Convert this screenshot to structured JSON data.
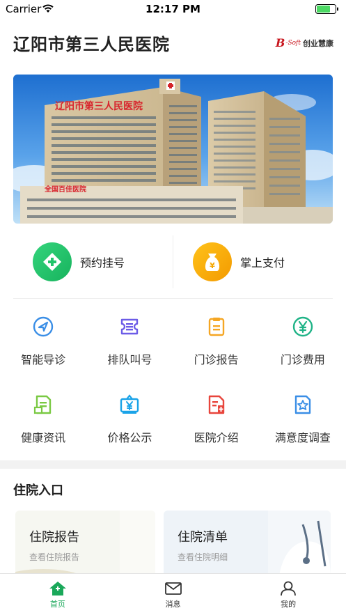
{
  "status_bar": {
    "carrier": "Carrier",
    "time": "12:17 PM"
  },
  "header": {
    "title": "辽阳市第三人民医院",
    "brand": {
      "b": "B",
      "soft": "-Soft",
      "cn": "创业慧康"
    }
  },
  "banner": {
    "sign_top": "辽阳市第三人民医院",
    "sign_bottom": "全国百佳医院"
  },
  "main_actions": [
    {
      "label": "预约挂号",
      "icon": "plus-cross-icon",
      "color": "#22c46a"
    },
    {
      "label": "掌上支付",
      "icon": "money-bag-icon",
      "color": "#f5a700"
    }
  ],
  "grid": [
    {
      "label": "智能导诊",
      "icon": "compass-icon",
      "color": "#3a8ee6"
    },
    {
      "label": "排队叫号",
      "icon": "ticket-icon",
      "color": "#6c5ce7"
    },
    {
      "label": "门诊报告",
      "icon": "clipboard-icon",
      "color": "#f5a623"
    },
    {
      "label": "门诊费用",
      "icon": "yuan-coin-icon",
      "color": "#1fb387"
    },
    {
      "label": "健康资讯",
      "icon": "news-icon",
      "color": "#7ac943"
    },
    {
      "label": "价格公示",
      "icon": "price-board-icon",
      "color": "#1aa3e8"
    },
    {
      "label": "医院介绍",
      "icon": "hospital-card-icon",
      "color": "#e8453c"
    },
    {
      "label": "满意度调查",
      "icon": "star-document-icon",
      "color": "#3a8ee6"
    }
  ],
  "inpatient": {
    "title": "住院入口",
    "cards": [
      {
        "title": "住院报告",
        "subtitle": "查看住院报告"
      },
      {
        "title": "住院清单",
        "subtitle": "查看住院明细"
      }
    ]
  },
  "tabs": [
    {
      "label": "首页",
      "icon": "home-icon",
      "active": true
    },
    {
      "label": "消息",
      "icon": "mail-icon",
      "active": false
    },
    {
      "label": "我的",
      "icon": "user-icon",
      "active": false
    }
  ],
  "colors": {
    "accent": "#1aa85a"
  }
}
